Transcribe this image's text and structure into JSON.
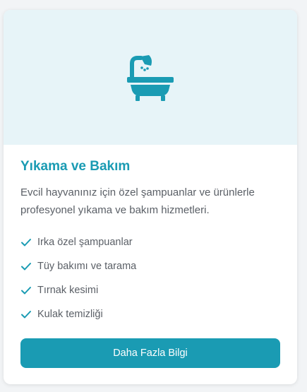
{
  "card": {
    "title": "Yıkama ve Bakım",
    "description": "Evcil hayvanınız için özel şampuanlar ve ürünlerle profesyonel yıkama ve bakım hizmetleri.",
    "features": [
      "Irka özel şampuanlar",
      "Tüy bakımı ve tarama",
      "Tırnak kesimi",
      "Kulak temizliği"
    ],
    "button_label": "Daha Fazla Bilgi",
    "hero_icon": "bathtub-icon",
    "feature_icon": "check-icon"
  },
  "colors": {
    "accent": "#1a9bb3",
    "hero_background": "#e7f4f8",
    "text": "#5a5f66"
  }
}
